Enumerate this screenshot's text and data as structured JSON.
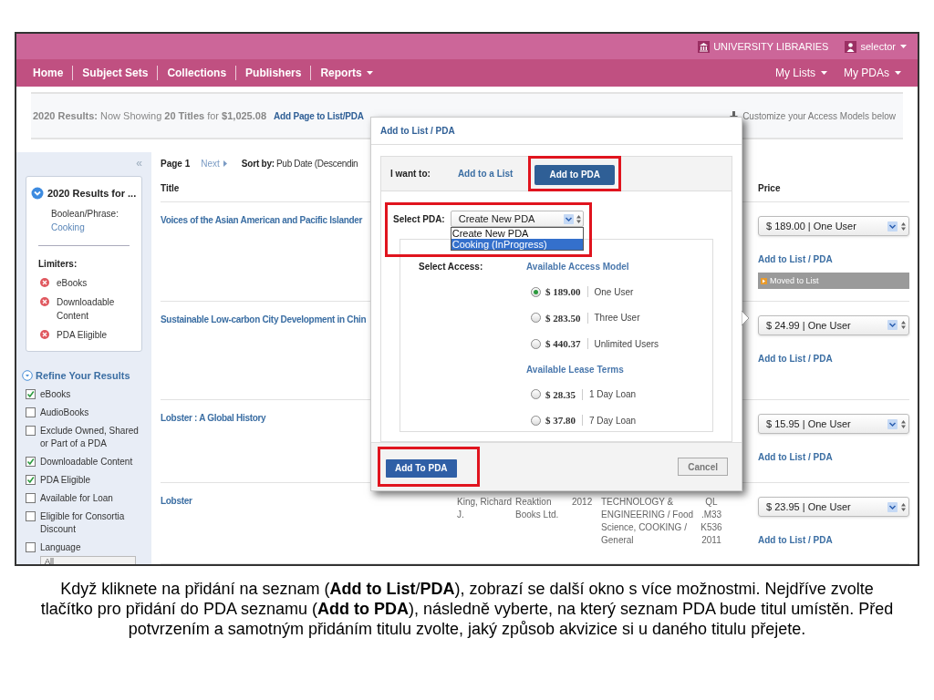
{
  "header": {
    "institution": "UNIVERSITY LIBRARIES",
    "user": "selector"
  },
  "nav": {
    "left": [
      {
        "label": "Home",
        "dropdown": false
      },
      {
        "label": "Subject Sets",
        "dropdown": false
      },
      {
        "label": "Collections",
        "dropdown": false
      },
      {
        "label": "Publishers",
        "dropdown": false
      },
      {
        "label": "Reports",
        "dropdown": true
      }
    ],
    "right": [
      {
        "label": "My Lists",
        "dropdown": true
      },
      {
        "label": "My PDAs",
        "dropdown": true
      }
    ]
  },
  "results_bar": {
    "summary": "**2020 Results:** Now Showing **20 Titles** for **$1,025.08**",
    "add_page_link": "Add Page to List/PDA",
    "hint": "Customize your Access Models below"
  },
  "sidebar": {
    "collapse": "«",
    "search_summary": {
      "title": "2020 Results for ...",
      "query_label": "Boolean/Phrase:",
      "query": "Cooking",
      "limiters_title": "Limiters:",
      "limiters": [
        "eBooks",
        "Downloadable Content",
        "PDA Eligible"
      ]
    },
    "refine": {
      "title": "Refine Your Results",
      "filters": [
        {
          "label": "eBooks",
          "checked": true
        },
        {
          "label": "AudioBooks",
          "checked": false
        },
        {
          "label": "Exclude Owned, Shared or Part of a PDA",
          "checked": false
        },
        {
          "label": "Downloadable Content",
          "checked": true
        },
        {
          "label": "PDA Eligible",
          "checked": true
        },
        {
          "label": "Available for Loan",
          "checked": false
        },
        {
          "label": "Eligible for Consortia Discount",
          "checked": false
        },
        {
          "label": "Language",
          "checked": false
        }
      ],
      "language_select": "All"
    }
  },
  "pager": {
    "page": "Page 1",
    "next": "Next",
    "sort_label": "Sort by:",
    "sort_value": "Pub Date (Descendin"
  },
  "table": {
    "columns": [
      "Title",
      "Price"
    ],
    "rows": [
      {
        "title": "Voices of the Asian American and Pacific Islander",
        "price": "$ 189.00 | One User",
        "link": "Add to List / PDA",
        "status": "Moved to List"
      },
      {
        "title": "Sustainable Low-carbon City Development in Chin",
        "price": "$ 24.99 | One User",
        "link": "Add to List / PDA"
      },
      {
        "title": "Lobster : A Global History",
        "price": "$ 15.95 | One User",
        "link": "Add to List / PDA"
      },
      {
        "title": "Lobster",
        "author": "King, Richard J.",
        "publisher": "Reaktion Books Ltd.",
        "year": "2012",
        "subject": "TECHNOLOGY & ENGINEERING / Food Science, COOKING / General",
        "call_number": "QL .M33 K536 2011",
        "price": "$ 23.95 | One User",
        "link": "Add to List / PDA"
      }
    ]
  },
  "modal": {
    "title": "Add to List / PDA",
    "want_label": "I want to:",
    "tabs": [
      {
        "label": "Add to a List",
        "selected": false,
        "highlighted": false
      },
      {
        "label": "Add to PDA",
        "selected": true,
        "highlighted": true
      }
    ],
    "select_label": "Select PDA:",
    "select_value": "Create New PDA",
    "select_highlighted": true,
    "options": [
      {
        "label": "Create New PDA",
        "selected": false
      },
      {
        "label": "Cooking (InProgress)",
        "selected": true
      }
    ],
    "access_label": "Select Access:",
    "access_heading": "Available Access Model",
    "access_options": [
      {
        "price": "$ 189.00",
        "label": "One User",
        "selected": true
      },
      {
        "price": "$ 283.50",
        "label": "Three User",
        "selected": false
      },
      {
        "price": "$ 440.37",
        "label": "Unlimited Users",
        "selected": false
      }
    ],
    "lease_heading": "Available Lease Terms",
    "lease_options": [
      {
        "price": "$ 28.35",
        "label": "1 Day Loan",
        "selected": false
      },
      {
        "price": "$ 37.80",
        "label": "7 Day Loan",
        "selected": false
      }
    ],
    "primary": {
      "label": "Add To PDA",
      "highlighted": true
    },
    "cancel": "Cancel"
  },
  "caption": "Když kliknete na přidání na seznam (**Add to List**/**PDA**), zobrazí se další okno s více možnostmi. Nejdříve zvolte tlačítko pro přidání do PDA seznamu (**Add to PDA**), následně vyberte, na který seznam PDA bude titul umístěn. Před potvrzením a samotným přidáním titulu zvolte, jaký způsob akvizice si u daného titulu přejete."
}
